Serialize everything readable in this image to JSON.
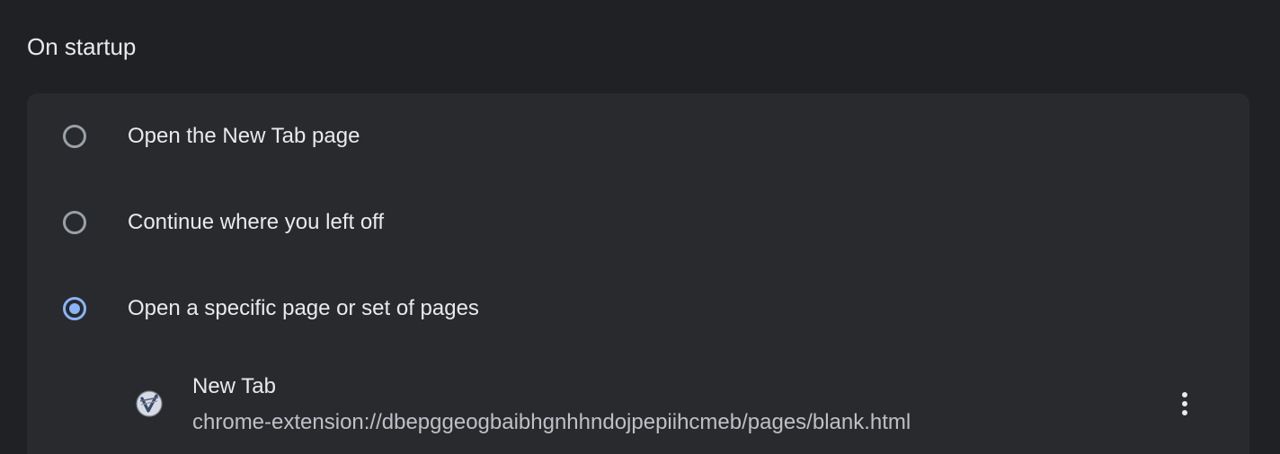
{
  "section": {
    "title": "On startup"
  },
  "startup_options": [
    {
      "label": "Open the New Tab page",
      "checked": false
    },
    {
      "label": "Continue where you left off",
      "checked": false
    },
    {
      "label": "Open a specific page or set of pages",
      "checked": true
    }
  ],
  "pages": [
    {
      "title": "New Tab",
      "url": "chrome-extension://dbepggeogbaibhgnhhndojpepiihcmeb/pages/blank.html",
      "icon": "vimium-extension-icon"
    }
  ],
  "colors": {
    "background": "#202124",
    "card": "#292a2d",
    "radio_unchecked": "#9aa0a6",
    "radio_checked": "#8ab4f8",
    "text_primary": "#e8eaed",
    "text_secondary": "#bdc1c6"
  }
}
